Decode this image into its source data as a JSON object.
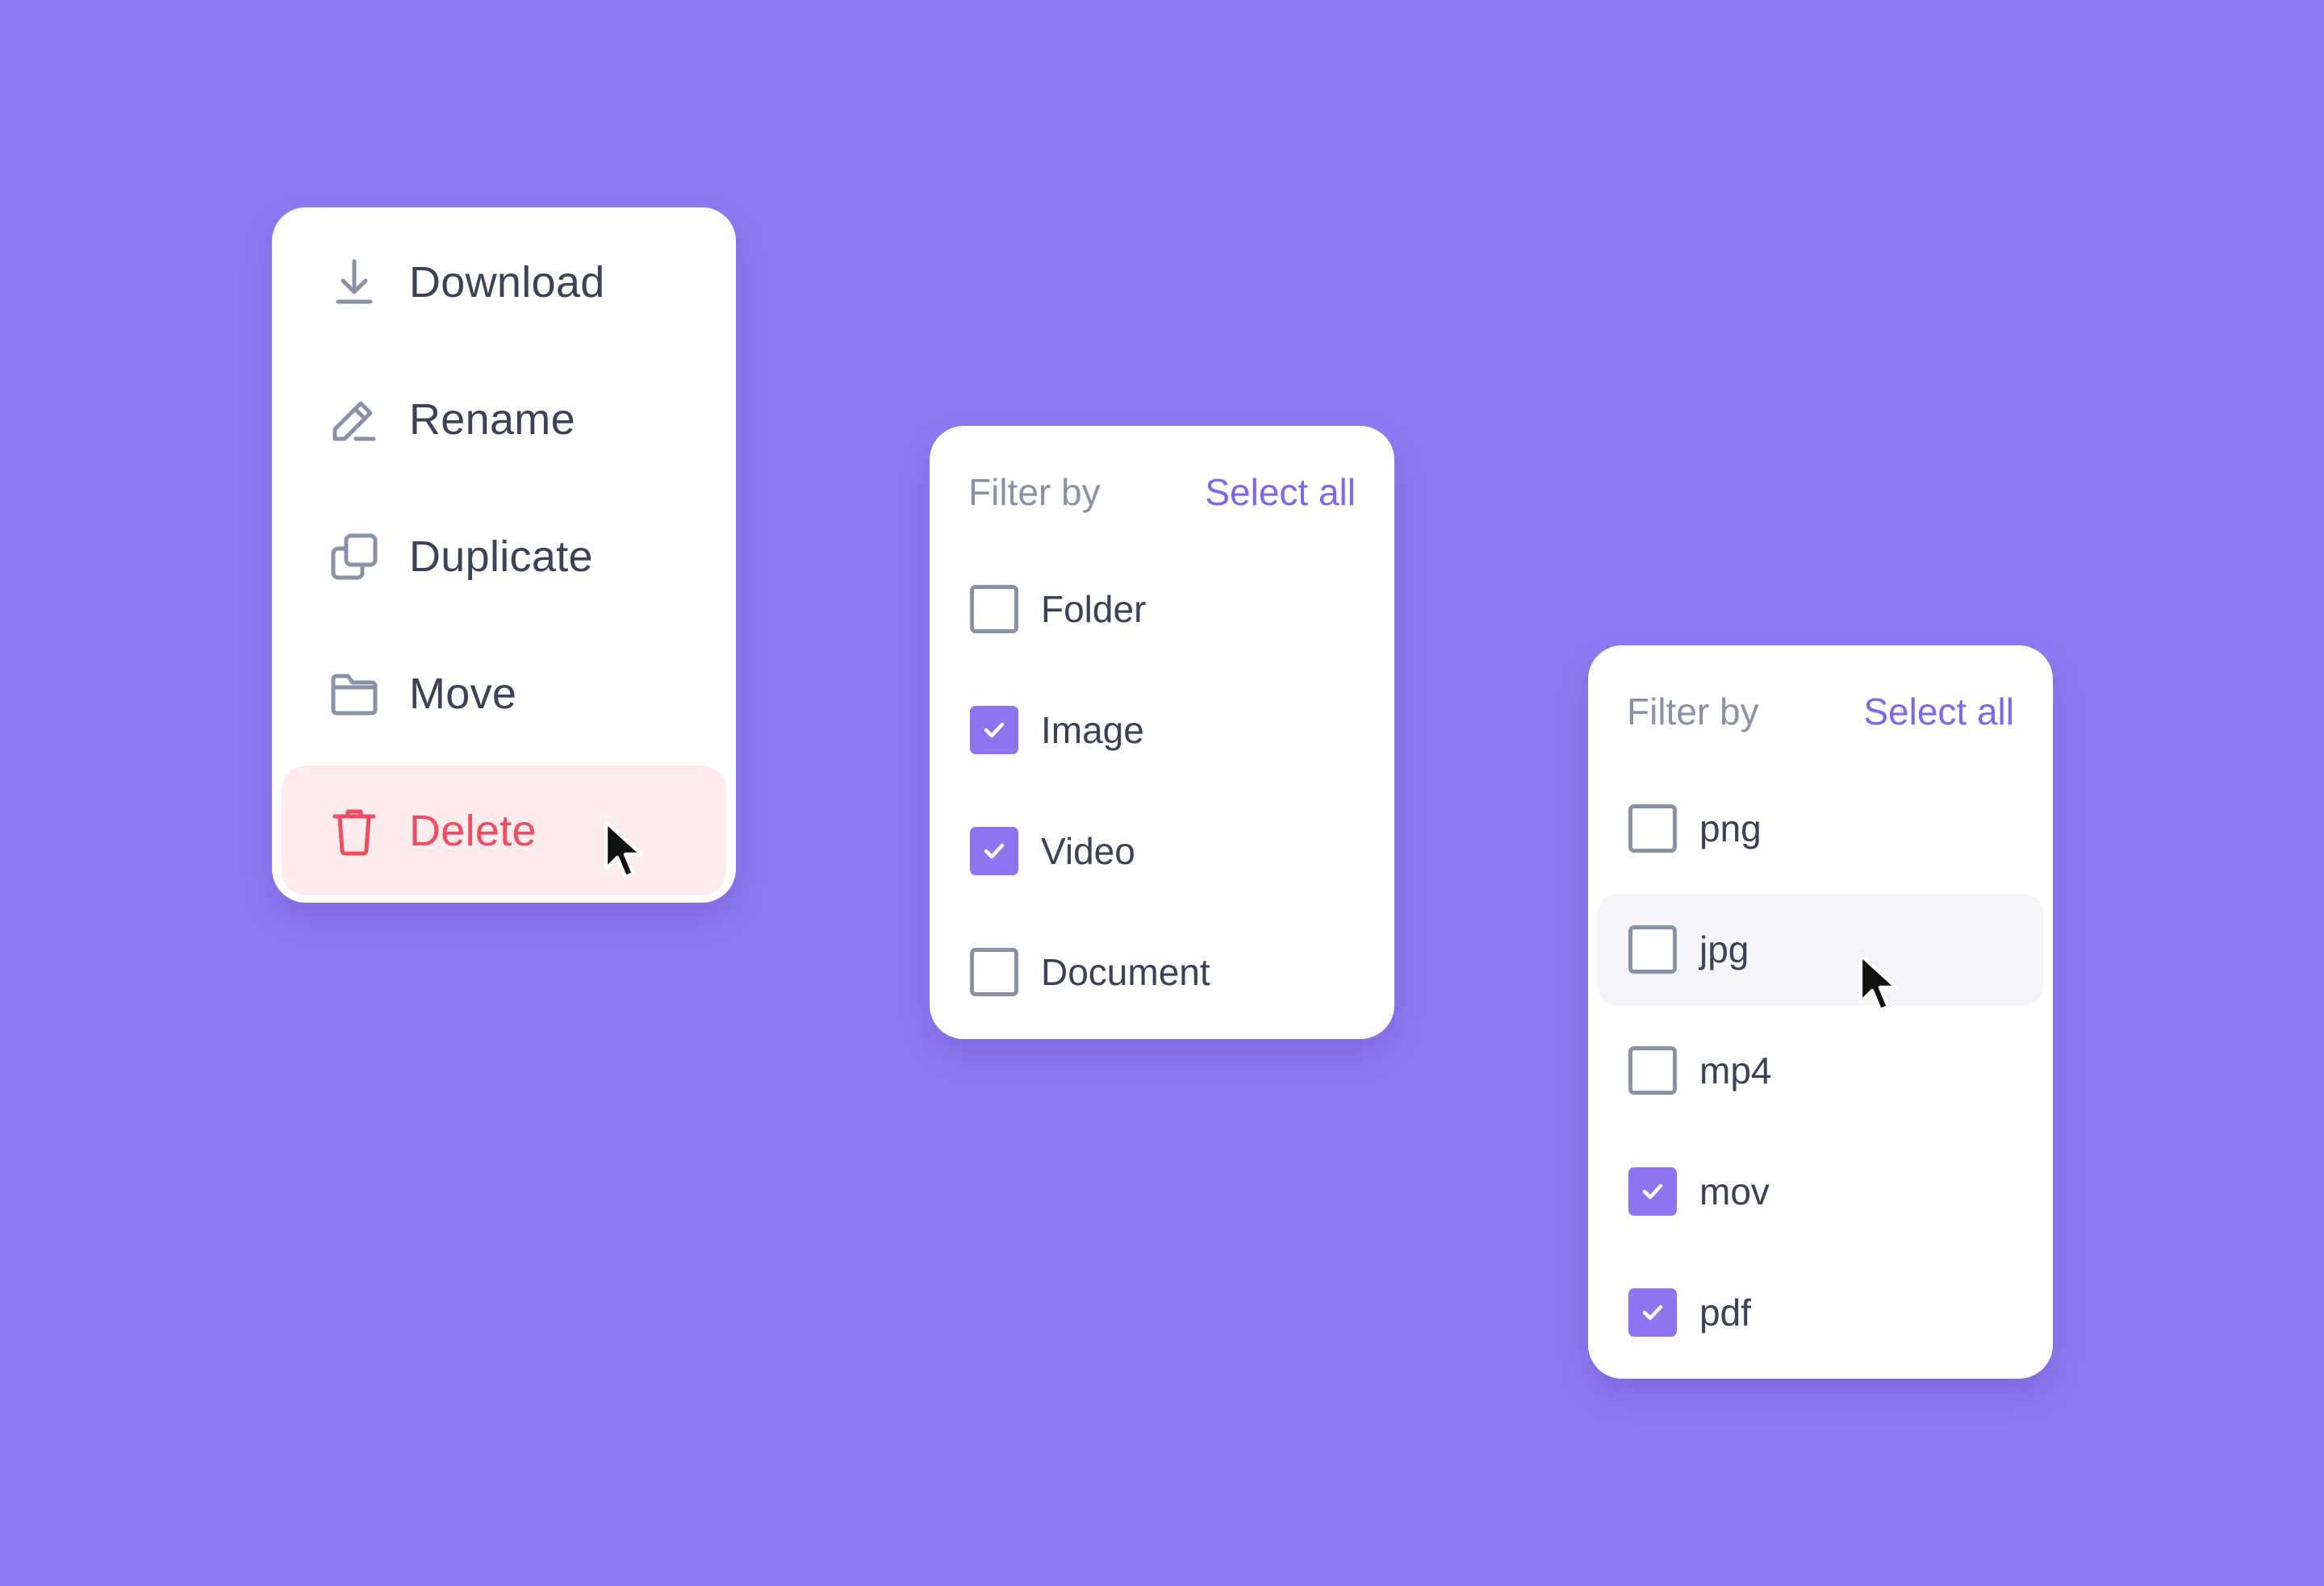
{
  "menu": {
    "items": [
      {
        "label": "Download",
        "icon": "download-icon",
        "variant": "default"
      },
      {
        "label": "Rename",
        "icon": "pencil-icon",
        "variant": "default"
      },
      {
        "label": "Duplicate",
        "icon": "duplicate-icon",
        "variant": "default"
      },
      {
        "label": "Move",
        "icon": "folder-icon",
        "variant": "default"
      },
      {
        "label": "Delete",
        "icon": "trash-icon",
        "variant": "danger"
      }
    ]
  },
  "filter_type": {
    "title": "Filter by",
    "select_all_label": "Select all",
    "options": [
      {
        "label": "Folder",
        "checked": false
      },
      {
        "label": "Image",
        "checked": true
      },
      {
        "label": "Video",
        "checked": true
      },
      {
        "label": "Document",
        "checked": false
      }
    ]
  },
  "filter_ext": {
    "title": "Filter by",
    "select_all_label": "Select all",
    "options": [
      {
        "label": "png",
        "checked": false
      },
      {
        "label": "jpg",
        "checked": false,
        "hovered": true
      },
      {
        "label": "mp4",
        "checked": false
      },
      {
        "label": "mov",
        "checked": true
      },
      {
        "label": "pdf",
        "checked": true
      }
    ]
  },
  "colors": {
    "background": "#8e79f3",
    "accent": "#7c68ec",
    "checkbox_checked": "#8e74ee",
    "danger": "#ef4b61",
    "danger_bg": "#fdebee",
    "text": "#3b4157",
    "muted": "#8a90a6"
  }
}
